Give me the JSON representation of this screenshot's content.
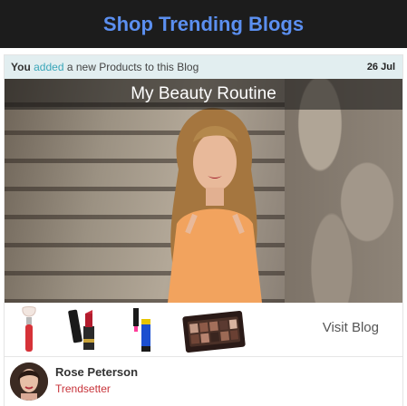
{
  "header": {
    "title": "Shop Trending Blogs"
  },
  "activity": {
    "subject": "You",
    "verb": "added",
    "rest": "a new Products to this Blog",
    "date": "26 Jul"
  },
  "post": {
    "title": "My Beauty Routine"
  },
  "products": [
    {
      "icon": "makeup-brush-icon"
    },
    {
      "icon": "lipstick-icon"
    },
    {
      "icon": "mascara-icon"
    },
    {
      "icon": "eyeshadow-palette-icon"
    }
  ],
  "visit_label": "Visit Blog",
  "author": {
    "name": "Rose Peterson",
    "role": "Trendsetter"
  },
  "colors": {
    "header_bg": "#1c1c1c",
    "title": "#5b8ff0",
    "accent": "#3aa6b9",
    "role": "#c8343b"
  }
}
